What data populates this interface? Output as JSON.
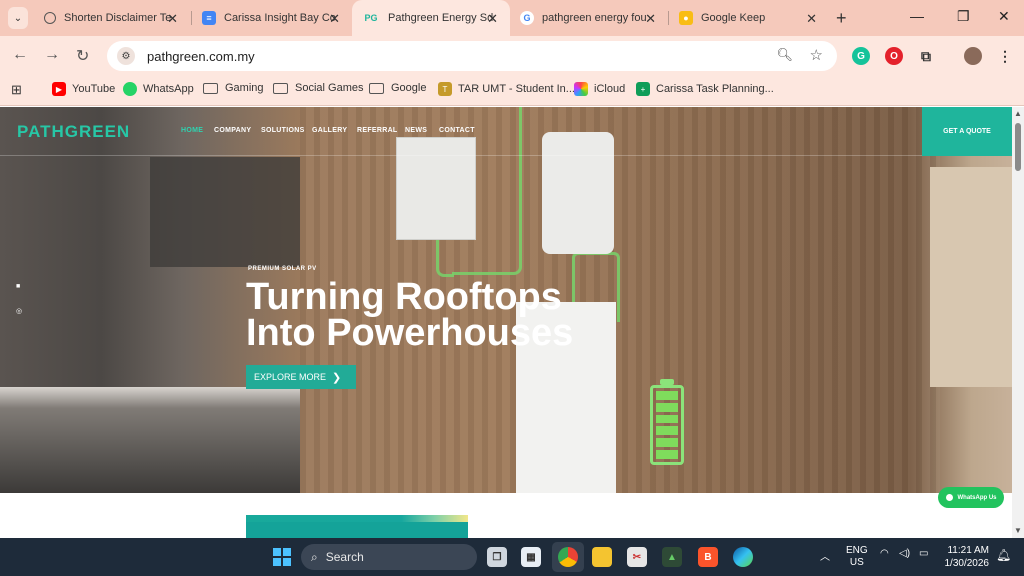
{
  "browser": {
    "tabs": [
      {
        "title": "Shorten Disclaimer Te",
        "favicon": "chatgpt-icon"
      },
      {
        "title": "Carissa Insight Bay Co",
        "favicon": "google-docs-icon"
      },
      {
        "title": "Pathgreen Energy Sdn",
        "favicon": "pathgreen-icon",
        "favicon_text": "PG",
        "active": true
      },
      {
        "title": "pathgreen energy fou",
        "favicon": "google-icon"
      },
      {
        "title": "Google Keep",
        "favicon": "google-keep-icon"
      }
    ],
    "url": "pathgreen.com.my",
    "bookmarks": [
      {
        "label": "YouTube",
        "icon": "youtube-icon"
      },
      {
        "label": "WhatsApp",
        "icon": "whatsapp-icon"
      },
      {
        "label": "Gaming",
        "icon": "folder-icon"
      },
      {
        "label": "Social Games",
        "icon": "folder-icon"
      },
      {
        "label": "Google",
        "icon": "folder-icon"
      },
      {
        "label": "TAR UMT - Student In...",
        "icon": "tarumt-icon"
      },
      {
        "label": "iCloud",
        "icon": "icloud-icon"
      },
      {
        "label": "Carissa Task Planning...",
        "icon": "google-sheets-icon"
      }
    ]
  },
  "site": {
    "logo": "PATHGREEN",
    "nav": [
      "HOME",
      "COMPANY",
      "SOLUTIONS",
      "GALLERY",
      "REFERRAL",
      "NEWS",
      "CONTACT"
    ],
    "active_nav": "HOME",
    "quote_button": "GET A QUOTE",
    "eyebrow": "PREMIUM SOLAR PV",
    "headline_line1": "Turning Rooftops",
    "headline_line2": "Into Powerhouses",
    "cta": "EXPLORE MORE",
    "whatsapp": "WhatsApp Us",
    "colors": {
      "brand": "#27c7a6",
      "cta": "#22ab97",
      "whatsapp": "#22c35e"
    }
  },
  "taskbar": {
    "search_placeholder": "Search",
    "lang_line1": "ENG",
    "lang_line2": "US",
    "time": "11:21 AM",
    "date": "1/30/2026"
  }
}
